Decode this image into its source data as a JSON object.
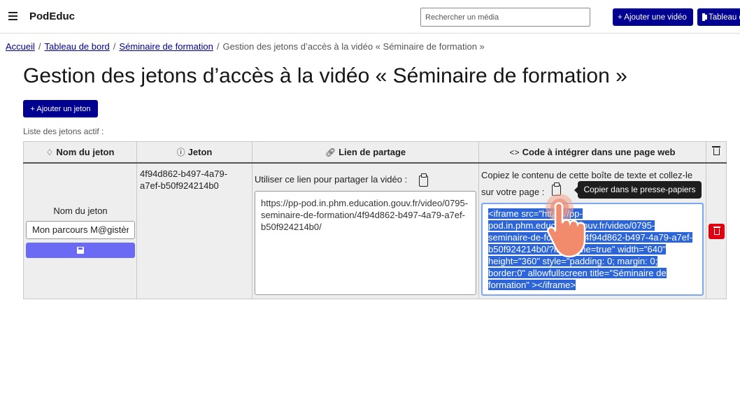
{
  "header": {
    "brand": "PodEduc",
    "search_placeholder": "Rechercher un média",
    "add_video_label": "+ Ajouter une vidéo",
    "dashboard_label": "Tableau de bord",
    "accent_color": "#000091"
  },
  "breadcrumb": {
    "items": [
      "Accueil",
      "Tableau de bord",
      "Séminaire de formation"
    ],
    "current": "Gestion des jetons d’accès à la vidéo « Séminaire de formation »"
  },
  "page": {
    "title": "Gestion des jetons d’accès à la vidéo « Séminaire de formation »",
    "add_token_label": "+ Ajouter un jeton",
    "list_label": "Liste des jetons actif :"
  },
  "table": {
    "headers": {
      "name": "Nom du jeton",
      "token": "Jeton",
      "link": "Lien de partage",
      "embed": "Code à intégrer dans une page web"
    },
    "row": {
      "name_label": "Nom du jeton",
      "name_value": "Mon parcours M@gistère",
      "token_line1": "4f94d862-b497-4a79-",
      "token_line2": "a7ef-b50f924214b0",
      "link_label": "Utiliser ce lien pour partager la vidéo :",
      "link_value": "https://pp-pod.in.phm.education.gouv.fr/video/0795-seminaire-de-formation/4f94d862-b497-4a79-a7ef-b50f924214b0/",
      "embed_label": "Copiez le contenu de cette boîte de texte et collez-le sur votre page :",
      "copy_tooltip": "Copier dans le presse-papiers",
      "embed_value": "<iframe src=\"https://pp-pod.in.phm.education.gouv.fr/video/0795-seminaire-de-formation/4f94d862-b497-4a79-a7ef-b50f924214b0/?is_iframe=true\" width=\"640\" height=\"360\" style=\"padding: 0; margin: 0; border:0\" allowfullscreen title=\"Séminaire de formation\" ></iframe>"
    }
  },
  "icons": {
    "menu": "hamburger-icon",
    "film": "film-icon",
    "tag": "tag-icon",
    "info": "info-icon",
    "link": "link-icon",
    "code": "code-icon",
    "trash": "trash-icon",
    "clipboard": "clipboard-icon",
    "save": "floppy-icon",
    "cursor": "hand-pointer-cursor"
  }
}
